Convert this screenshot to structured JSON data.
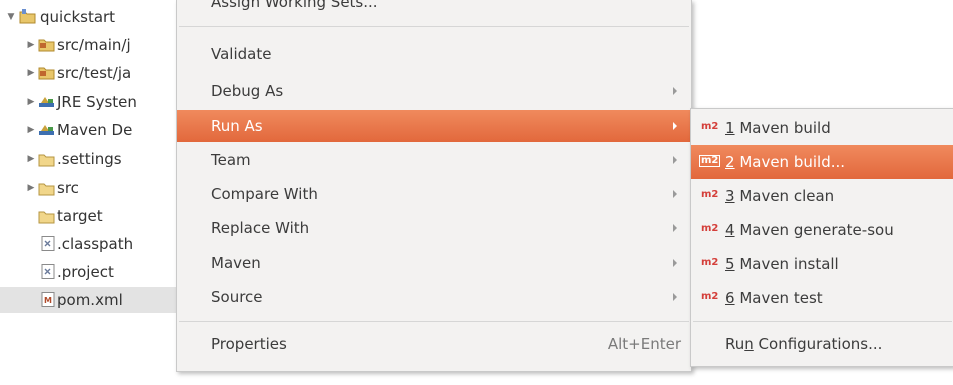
{
  "tree": {
    "items": [
      {
        "label": "quickstart",
        "icon": "project-folder-icon"
      },
      {
        "label": "src/main/j",
        "icon": "source-folder-icon"
      },
      {
        "label": "src/test/ja",
        "icon": "source-folder-icon"
      },
      {
        "label": "JRE Systen",
        "icon": "library-icon"
      },
      {
        "label": "Maven De",
        "icon": "library-icon"
      },
      {
        "label": ".settings",
        "icon": "folder-icon"
      },
      {
        "label": "src",
        "icon": "folder-icon"
      },
      {
        "label": "target",
        "icon": "folder-icon"
      },
      {
        "label": ".classpath",
        "icon": "file-icon"
      },
      {
        "label": ".project",
        "icon": "file-icon"
      },
      {
        "label": "pom.xml",
        "icon": "maven-pom-icon"
      }
    ]
  },
  "menu": {
    "items": [
      {
        "label": "Assign Working Sets..."
      },
      {
        "label": "Validate"
      },
      {
        "label": "Debug As"
      },
      {
        "label": "Run As"
      },
      {
        "label": "Team"
      },
      {
        "label": "Compare With"
      },
      {
        "label": "Replace With"
      },
      {
        "label": "Maven"
      },
      {
        "label": "Source"
      },
      {
        "label": "Properties",
        "shortcut": "Alt+Enter"
      }
    ]
  },
  "submenu": {
    "items": [
      {
        "mnemonic": "1",
        "label": " Maven build",
        "icon_text": "m2"
      },
      {
        "mnemonic": "2",
        "label": " Maven build...",
        "icon_text": "m2"
      },
      {
        "mnemonic": "3",
        "label": " Maven clean",
        "icon_text": "m2"
      },
      {
        "mnemonic": "4",
        "label": " Maven generate-sou",
        "icon_text": "m2"
      },
      {
        "mnemonic": "5",
        "label": " Maven install",
        "icon_text": "m2"
      },
      {
        "mnemonic": "6",
        "label": " Maven test",
        "icon_text": "m2"
      }
    ],
    "run_config": {
      "pre": "Ru",
      "mnemonic": "n",
      "post": " Configurations..."
    }
  },
  "colors": {
    "highlight": "#e8754a",
    "maven_red": "#d43f3a",
    "menu_bg": "#f3f2f1"
  }
}
